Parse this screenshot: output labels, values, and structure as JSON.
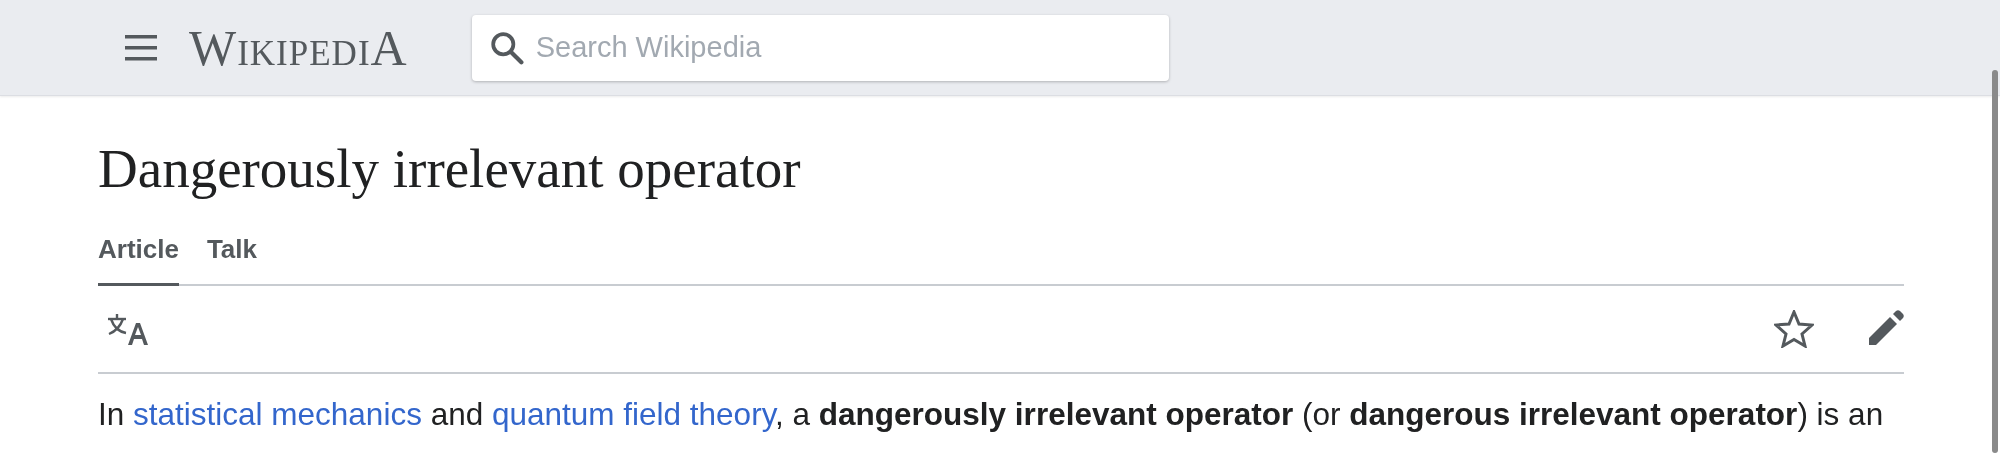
{
  "header": {
    "logo": "WikipediA",
    "search": {
      "placeholder": "Search Wikipedia"
    }
  },
  "title": "Dangerously irrelevant operator",
  "tabs": [
    {
      "label": "Article",
      "selected": true
    },
    {
      "label": "Talk",
      "selected": false
    }
  ],
  "paragraph": [
    {
      "kind": "text",
      "text": "In "
    },
    {
      "kind": "link",
      "text": "statistical mechanics"
    },
    {
      "kind": "text",
      "text": " and "
    },
    {
      "kind": "link",
      "text": "quantum field theory"
    },
    {
      "kind": "text",
      "text": ", a **dangerously irrelevant operator** (or **dangerous irrelevant operator**) is an"
    }
  ]
}
